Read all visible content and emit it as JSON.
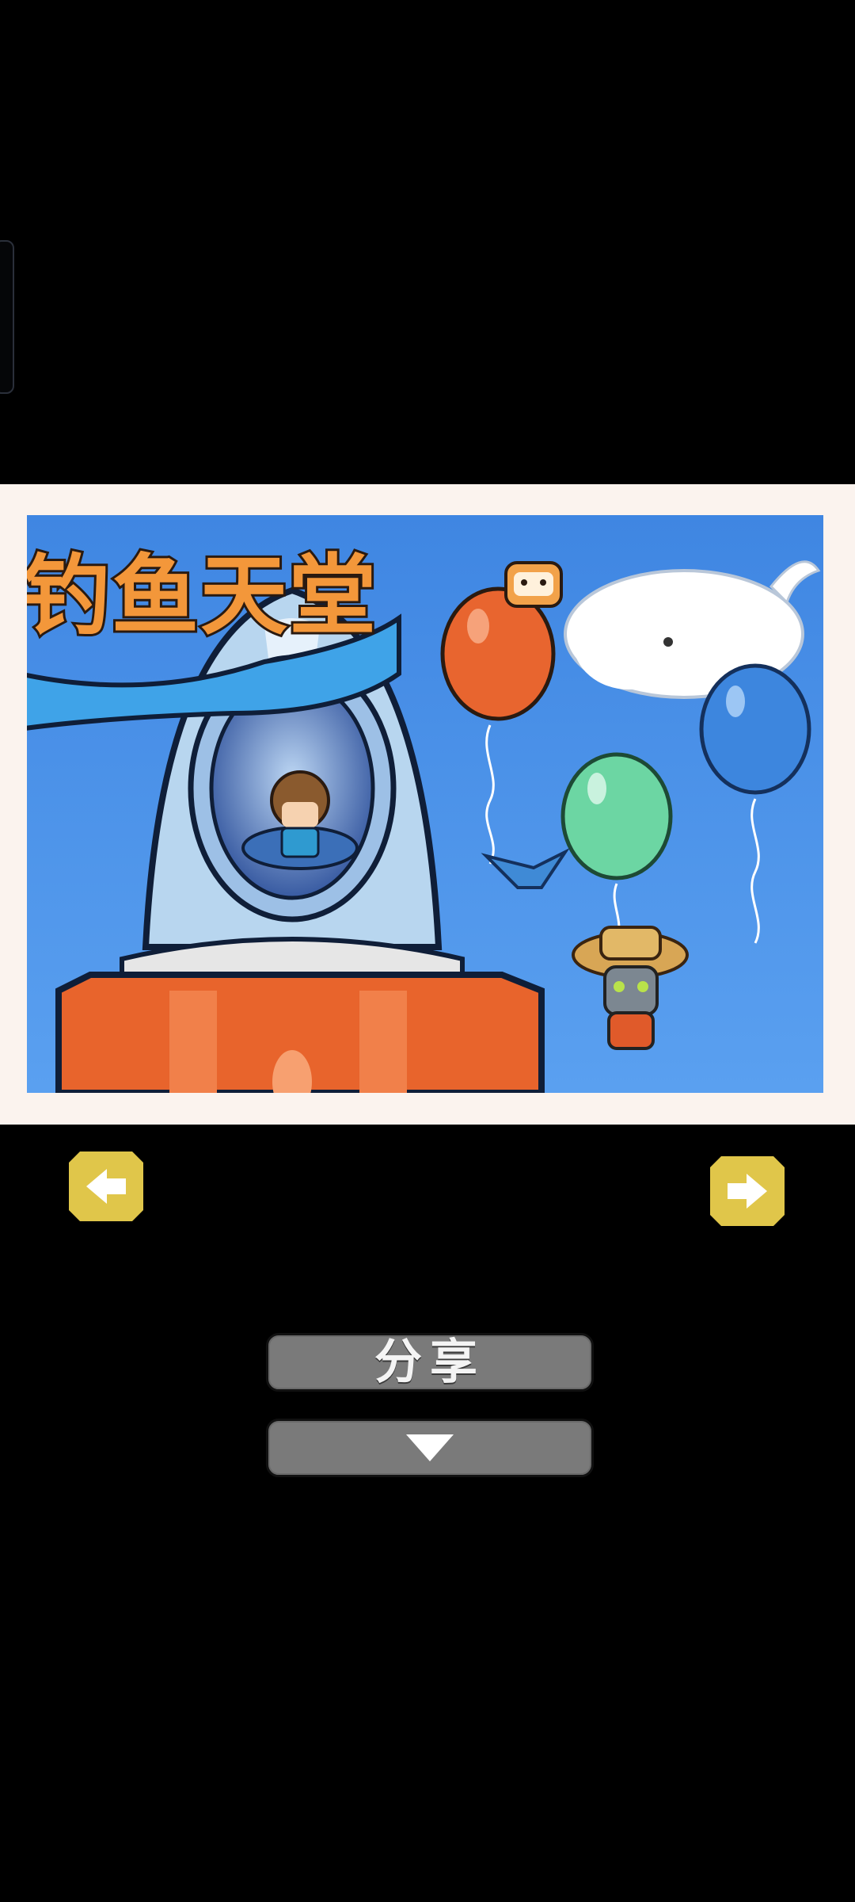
{
  "game": {
    "title": "钓鱼天堂"
  },
  "buttons": {
    "share_label": "分享",
    "prev_icon": "arrow-left-icon",
    "next_icon": "arrow-right-icon",
    "more_icon": "triangle-down-icon"
  },
  "colors": {
    "background": "#000000",
    "frame": "#fbf3ee",
    "sky": "#4a8fe6",
    "nav_button": "#e0c64a",
    "pill": "#7a7a7a",
    "title_orange": "#f3973a"
  }
}
